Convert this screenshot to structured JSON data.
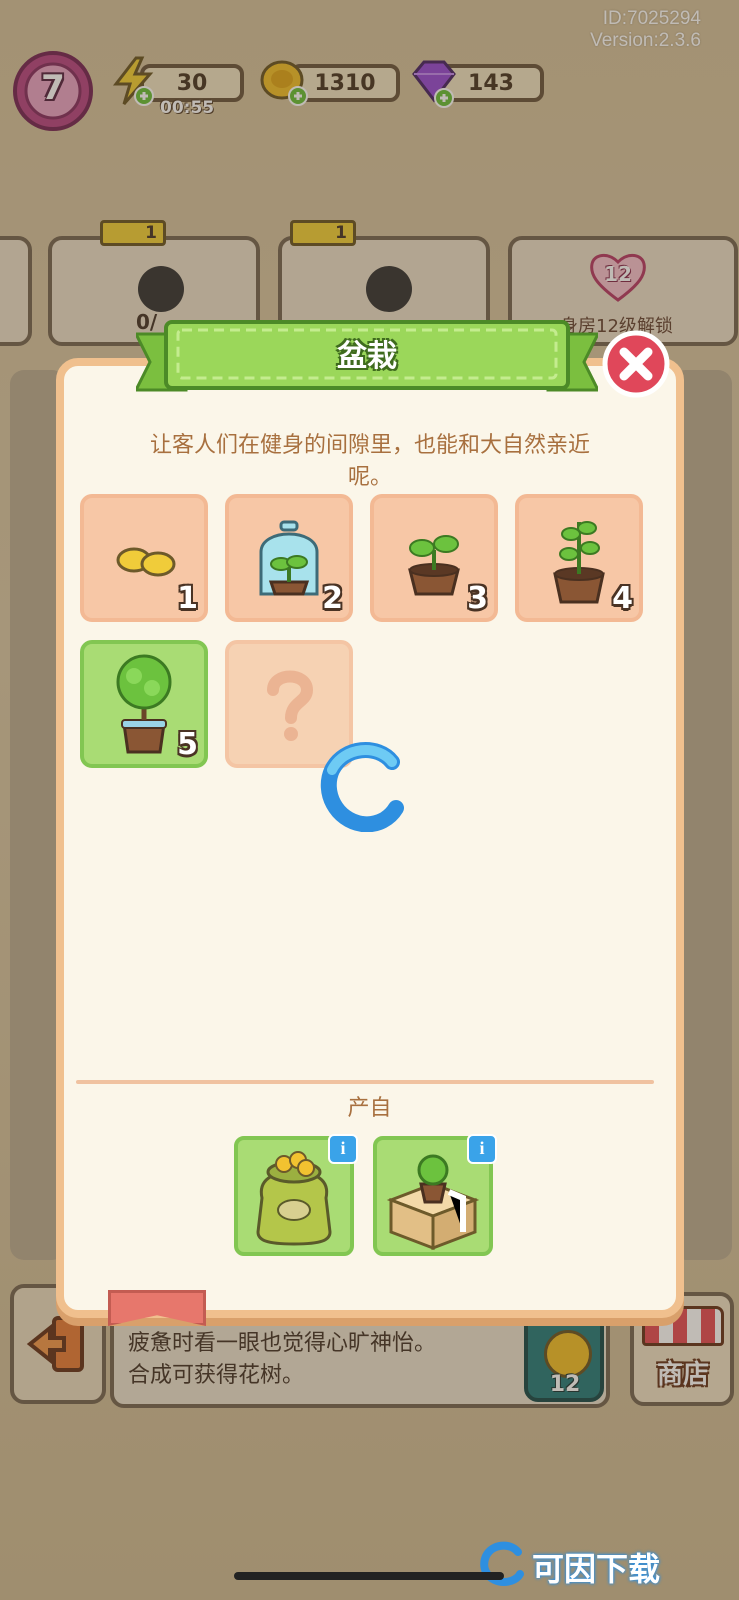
{
  "status": {
    "id": "ID:7025294",
    "version": "Version:2.3.6"
  },
  "hud": {
    "level": "7",
    "energy": "30",
    "energy_timer": "00:55",
    "coins": "1310",
    "gems": "143"
  },
  "background": {
    "card_star_1": "1",
    "card_star_2": "1",
    "card_progress": "0/",
    "lock_level": "12",
    "lock_text": "身房12级解锁",
    "item_desc_line1": "疲惫时看一眼也觉得心旷神怡。",
    "item_desc_line2": "合成可获得花树。",
    "shop_label": "商店",
    "price": "12"
  },
  "dialog": {
    "title": "盆栽",
    "description_line1": "让客人们在健身的间隙里，也能和大自然亲近",
    "description_line2": "呢。",
    "chain": [
      {
        "level": "1",
        "icon": "seeds-icon"
      },
      {
        "level": "2",
        "icon": "sprout-in-glass-dome-icon"
      },
      {
        "level": "3",
        "icon": "seedling-pot-icon"
      },
      {
        "level": "4",
        "icon": "young-plant-pot-icon"
      },
      {
        "level": "5",
        "icon": "bush-pot-icon",
        "selected": true
      },
      {
        "level": "",
        "icon": "question-mark-icon",
        "locked": true
      }
    ],
    "source_label": "产自",
    "sources": [
      {
        "icon": "seed-sack-icon"
      },
      {
        "icon": "plant-box-icon"
      }
    ]
  },
  "watermark": {
    "text": "可因下载"
  },
  "colors": {
    "panel_border": "#f0c08e",
    "ribbon_green": "#8ccf4f",
    "close_red": "#e0475a",
    "info_blue": "#3aa3e9"
  }
}
